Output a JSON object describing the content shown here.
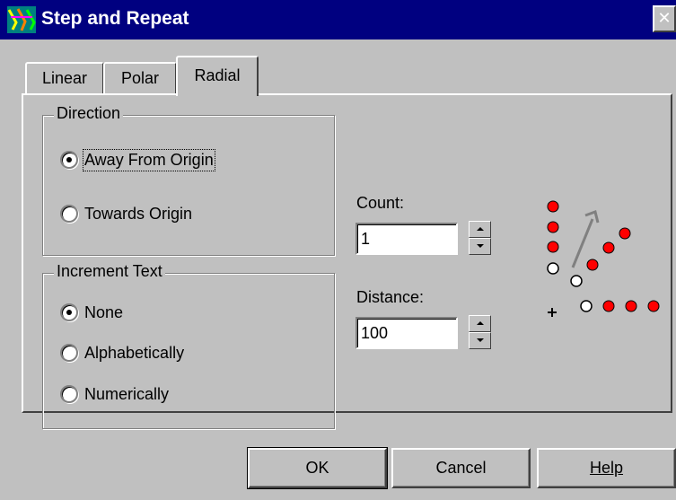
{
  "window": {
    "title": "Step and Repeat",
    "close_glyph": "✕",
    "icon": "step-repeat-app-icon"
  },
  "tabs": [
    {
      "label": "Linear",
      "selected": false
    },
    {
      "label": "Polar",
      "selected": false
    },
    {
      "label": "Radial",
      "selected": true
    }
  ],
  "direction": {
    "label": "Direction",
    "options": [
      {
        "label": "Away From Origin",
        "checked": true
      },
      {
        "label": "Towards Origin",
        "checked": false
      }
    ]
  },
  "increment_text": {
    "label": "Increment Text",
    "options": [
      {
        "label": "None",
        "checked": true
      },
      {
        "label": "Alphabetically",
        "checked": false
      },
      {
        "label": "Numerically",
        "checked": false
      }
    ]
  },
  "count": {
    "label": "Count:",
    "value": "1"
  },
  "distance": {
    "label": "Distance:",
    "value": "100"
  },
  "buttons": {
    "ok": "OK",
    "cancel": "Cancel",
    "help": "Help"
  },
  "colors": {
    "titlebar": "#000080",
    "face": "#c0c0c0",
    "dot": "#ff0000"
  }
}
